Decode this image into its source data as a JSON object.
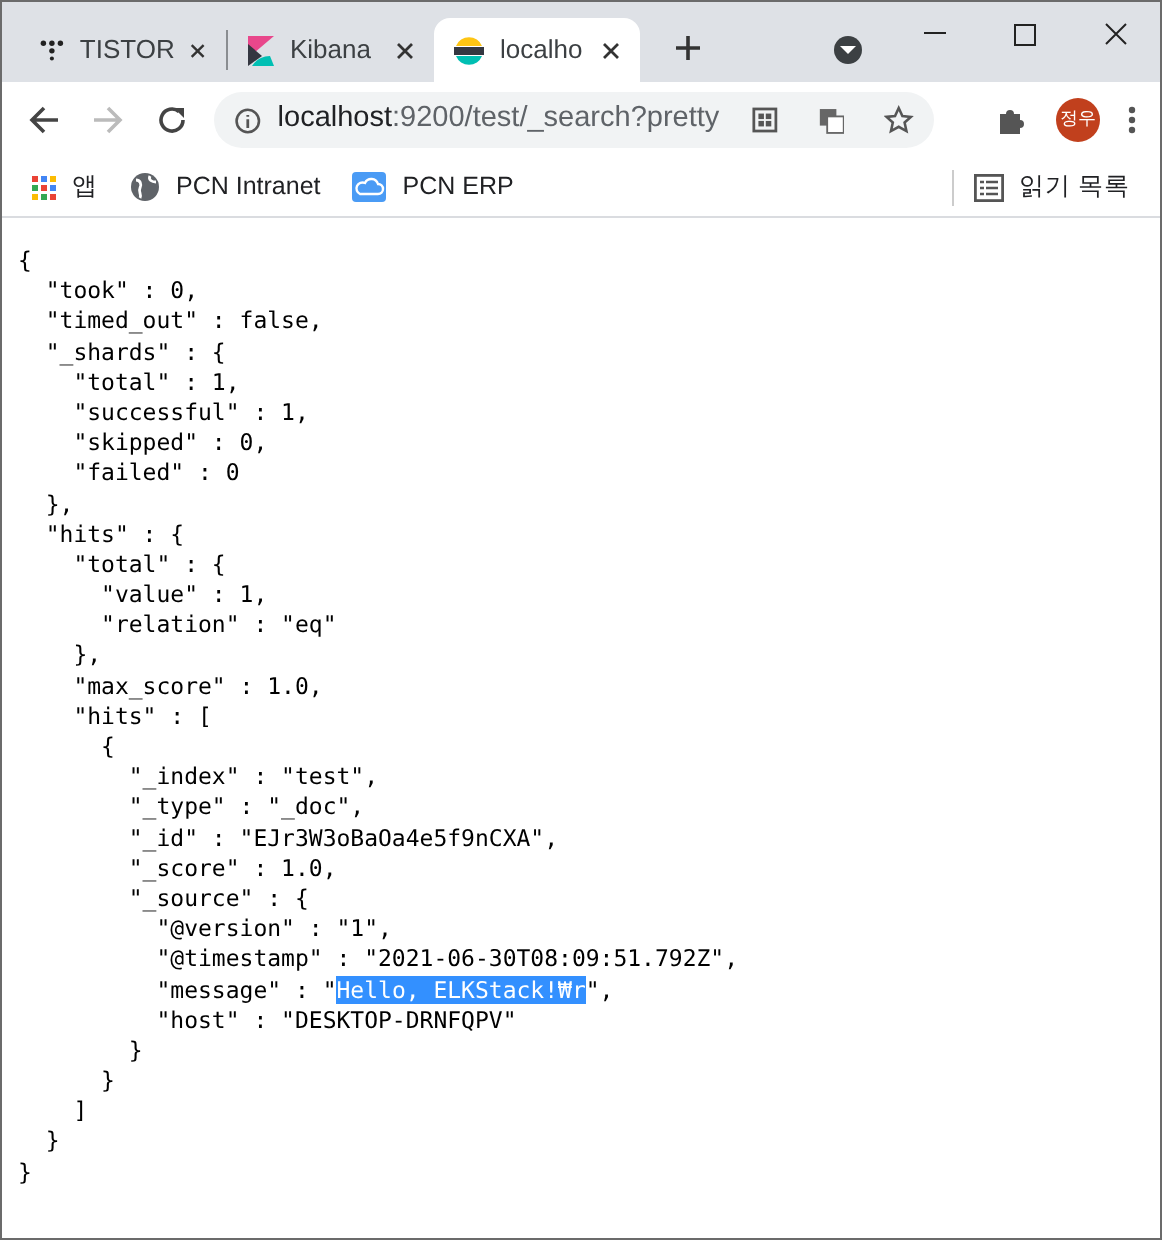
{
  "tabs": [
    {
      "title": "TISTOR",
      "selected": false
    },
    {
      "title": "Kibana",
      "selected": false
    },
    {
      "title": "localho",
      "selected": true
    }
  ],
  "address_bar": {
    "host": "localhost",
    "path": ":9200/test/_search?pretty"
  },
  "profile": {
    "initials": "정우"
  },
  "bookmarks": [
    {
      "label": "앱"
    },
    {
      "label": "PCN Intranet"
    },
    {
      "label": "PCN ERP"
    }
  ],
  "reading_list": {
    "label": "읽기 목록"
  },
  "content": {
    "lines": [
      {
        "segments": [
          {
            "text": "{",
            "selected": false
          }
        ]
      },
      {
        "segments": [
          {
            "text": "  \"took\" : 0,",
            "selected": false
          }
        ]
      },
      {
        "segments": [
          {
            "text": "  \"timed_out\" : false,",
            "selected": false
          }
        ]
      },
      {
        "segments": [
          {
            "text": "  \"_shards\" : {",
            "selected": false
          }
        ]
      },
      {
        "segments": [
          {
            "text": "    \"total\" : 1,",
            "selected": false
          }
        ]
      },
      {
        "segments": [
          {
            "text": "    \"successful\" : 1,",
            "selected": false
          }
        ]
      },
      {
        "segments": [
          {
            "text": "    \"skipped\" : 0,",
            "selected": false
          }
        ]
      },
      {
        "segments": [
          {
            "text": "    \"failed\" : 0",
            "selected": false
          }
        ]
      },
      {
        "segments": [
          {
            "text": "  },",
            "selected": false
          }
        ]
      },
      {
        "segments": [
          {
            "text": "  \"hits\" : {",
            "selected": false
          }
        ]
      },
      {
        "segments": [
          {
            "text": "    \"total\" : {",
            "selected": false
          }
        ]
      },
      {
        "segments": [
          {
            "text": "      \"value\" : 1,",
            "selected": false
          }
        ]
      },
      {
        "segments": [
          {
            "text": "      \"relation\" : \"eq\"",
            "selected": false
          }
        ]
      },
      {
        "segments": [
          {
            "text": "    },",
            "selected": false
          }
        ]
      },
      {
        "segments": [
          {
            "text": "    \"max_score\" : 1.0,",
            "selected": false
          }
        ]
      },
      {
        "segments": [
          {
            "text": "    \"hits\" : [",
            "selected": false
          }
        ]
      },
      {
        "segments": [
          {
            "text": "      {",
            "selected": false
          }
        ]
      },
      {
        "segments": [
          {
            "text": "        \"_index\" : \"test\",",
            "selected": false
          }
        ]
      },
      {
        "segments": [
          {
            "text": "        \"_type\" : \"_doc\",",
            "selected": false
          }
        ]
      },
      {
        "segments": [
          {
            "text": "        \"_id\" : \"EJr3W3oBaOa4e5f9nCXA\",",
            "selected": false
          }
        ]
      },
      {
        "segments": [
          {
            "text": "        \"_score\" : 1.0,",
            "selected": false
          }
        ]
      },
      {
        "segments": [
          {
            "text": "        \"_source\" : {",
            "selected": false
          }
        ]
      },
      {
        "segments": [
          {
            "text": "          \"@version\" : \"1\",",
            "selected": false
          }
        ]
      },
      {
        "segments": [
          {
            "text": "          \"@timestamp\" : \"2021-06-30T08:09:51.792Z\",",
            "selected": false
          }
        ]
      },
      {
        "segments": [
          {
            "text": "          \"message\" : \"",
            "selected": false
          },
          {
            "text": "Hello, ELKStack!₩r",
            "selected": true
          },
          {
            "text": "\",",
            "selected": false
          }
        ]
      },
      {
        "segments": [
          {
            "text": "          \"host\" : \"DESKTOP-DRNFQPV\"",
            "selected": false
          }
        ]
      },
      {
        "segments": [
          {
            "text": "        }",
            "selected": false
          }
        ]
      },
      {
        "segments": [
          {
            "text": "      }",
            "selected": false
          }
        ]
      },
      {
        "segments": [
          {
            "text": "    ]",
            "selected": false
          }
        ]
      },
      {
        "segments": [
          {
            "text": "  }",
            "selected": false
          }
        ]
      },
      {
        "segments": [
          {
            "text": "}",
            "selected": false
          }
        ]
      }
    ]
  }
}
